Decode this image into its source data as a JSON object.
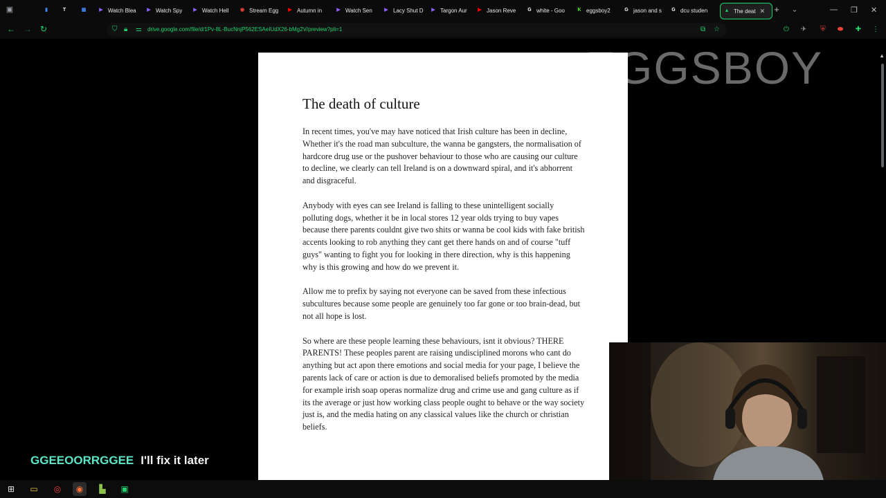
{
  "browser": {
    "tabs": [
      {
        "label": "",
        "favicon": "drive-icon",
        "color": "#4285f4",
        "glyph": "▮"
      },
      {
        "label": "",
        "favicon": "tweetdeck-icon",
        "color": "#ffffff",
        "glyph": "T"
      },
      {
        "label": "",
        "favicon": "media-icon",
        "color": "#4285f4",
        "glyph": "▦"
      },
      {
        "label": "Watch Blea",
        "favicon": "play-icon",
        "color": "#8b5cf6",
        "glyph": "▶"
      },
      {
        "label": "Watch Spy",
        "favicon": "play-icon",
        "color": "#8b5cf6",
        "glyph": "▶"
      },
      {
        "label": "Watch Hell",
        "favicon": "play-icon",
        "color": "#8b5cf6",
        "glyph": "▶"
      },
      {
        "label": "Stream Egg",
        "favicon": "stream-icon",
        "color": "#ea4335",
        "glyph": "◉"
      },
      {
        "label": "Autumn in",
        "favicon": "youtube-icon",
        "color": "#ff0000",
        "glyph": "▶"
      },
      {
        "label": "Watch Sen",
        "favicon": "play-icon",
        "color": "#8b5cf6",
        "glyph": "▶"
      },
      {
        "label": "Lacy Shut D",
        "favicon": "play-icon",
        "color": "#8b5cf6",
        "glyph": "▶"
      },
      {
        "label": "Targon Aur",
        "favicon": "play-icon",
        "color": "#8b5cf6",
        "glyph": "▶"
      },
      {
        "label": "Jason Reve",
        "favicon": "youtube-icon",
        "color": "#ff0000",
        "glyph": "▶"
      },
      {
        "label": "white - Goo",
        "favicon": "google-icon",
        "color": "#ffffff",
        "glyph": "G"
      },
      {
        "label": "eggsboy2",
        "favicon": "kick-icon",
        "color": "#53fc18",
        "glyph": "K"
      },
      {
        "label": "jason and s",
        "favicon": "google-icon",
        "color": "#ffffff",
        "glyph": "G"
      },
      {
        "label": "dcu studen",
        "favicon": "google-icon",
        "color": "#ffffff",
        "glyph": "G"
      },
      {
        "label": "The deat",
        "favicon": "drive-icon",
        "color": "#1dd46d",
        "glyph": "▲",
        "active": true
      }
    ],
    "url_host": "drive.google.com",
    "url_path": "/file/d/1Pv-8L-BucNnjP562ESAeIUdX26-bMg2V/preview?pli=1"
  },
  "document": {
    "title": "The death of culture",
    "paragraphs": [
      "In recent times, you've may have noticed that Irish culture has been in decline,\nWhether it's the road man subculture, the wanna be gangsters, the normalisation of hardcore drug use or the pushover behaviour to those who are causing our culture to decline, we clearly can tell Ireland is on a downward spiral, and it's abhorrent and disgraceful.",
      "Anybody with eyes can see Ireland is falling to these unintelligent socially polluting dogs, whether it be in local stores 12 year olds trying to buy vapes because there parents couldnt give two shits or wanna be cool kids with fake british accents looking to rob anything they cant get there hands on and of course \"tuff guys\" wanting to fight you for looking in there direction, why is this happening why is this growing and how do we prevent it.",
      "Allow me to prefix by saying not everyone can be saved from these infectious subcultures because some people are genuinely too far gone or too brain-dead, but not all hope is lost.",
      "So where are these people learning these behaviours, isnt it obvious? THERE PARENTS! These peoples parent are raising undisciplined morons who cant do anything but act apon there emotions and social media for your page, I believe the parents lack of care or action is due to demoralised beliefs promoted by the media for example irish soap operas normalize drug and crime use and gang culture as if its the average or just how working class people ought to behave or the way society just is, and the media hating on any classical values like the church or christian beliefs."
    ]
  },
  "overlay": {
    "background_logo": "EGGSBOY",
    "chat_user": "GGEEOORRGGEE",
    "chat_message": "I'll fix it later"
  },
  "colors": {
    "accent": "#1dd46d",
    "chat_user": "#5ce6c8"
  }
}
